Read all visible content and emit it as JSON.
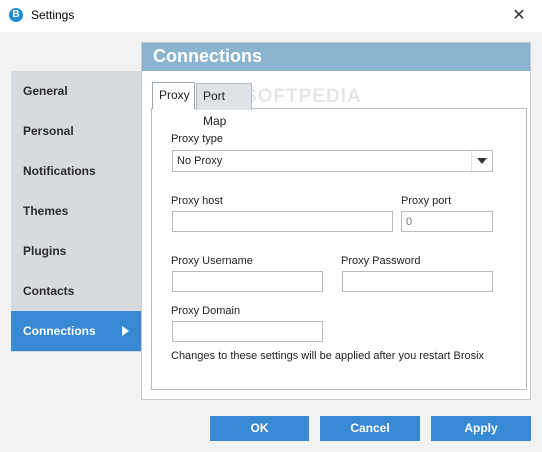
{
  "window": {
    "title": "Settings",
    "close_glyph": "✕",
    "app_icon_glyph": "B"
  },
  "sidebar": {
    "items": [
      {
        "label": "General"
      },
      {
        "label": "Personal"
      },
      {
        "label": "Notifications"
      },
      {
        "label": "Themes"
      },
      {
        "label": "Plugins"
      },
      {
        "label": "Contacts"
      },
      {
        "label": "Connections",
        "active": true
      }
    ]
  },
  "panel": {
    "title": "Connections",
    "tabs": [
      {
        "label": "Proxy",
        "active": true
      },
      {
        "label": "Port Map"
      }
    ],
    "watermark": "SOFTPEDIA",
    "proxy": {
      "type_label": "Proxy type",
      "type_value": "No Proxy",
      "host_label": "Proxy host",
      "host_value": "",
      "port_label": "Proxy port",
      "port_value": "0",
      "username_label": "Proxy Username",
      "username_value": "",
      "password_label": "Proxy Password",
      "password_value": "",
      "domain_label": "Proxy Domain",
      "domain_value": "",
      "note": "Changes to these settings will be applied after you restart Brosix"
    }
  },
  "buttons": {
    "ok": "OK",
    "cancel": "Cancel",
    "apply": "Apply"
  },
  "colors": {
    "accent": "#3789d4",
    "header": "#8ab4cf",
    "sidebar": "#d7dadf"
  }
}
